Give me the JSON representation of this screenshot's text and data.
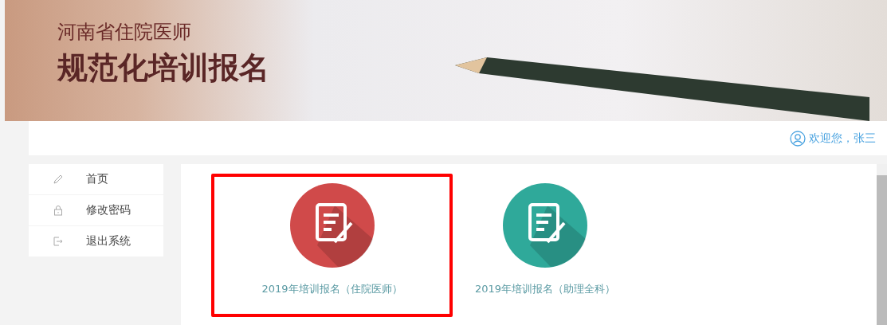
{
  "banner": {
    "subtitle": "河南省住院医师",
    "title": "规范化培训报名"
  },
  "user": {
    "greeting": "欢迎您，张三"
  },
  "sidebar": {
    "items": [
      {
        "kind": "home",
        "label": "首页"
      },
      {
        "kind": "password",
        "label": "修改密码"
      },
      {
        "kind": "logout",
        "label": "退出系统"
      }
    ]
  },
  "cards": [
    {
      "label": "2019年培训报名（住院医师）",
      "color": "#d04a4a",
      "highlighted": true
    },
    {
      "label": "2019年培训报名（助理全科）",
      "color": "#2fa99a",
      "highlighted": false
    }
  ]
}
